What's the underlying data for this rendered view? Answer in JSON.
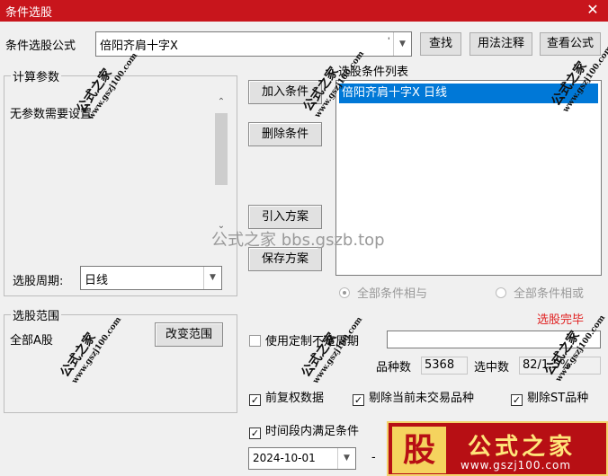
{
  "window": {
    "title": "条件选股",
    "close_glyph": "✕"
  },
  "formula": {
    "label": "条件选股公式",
    "value": "倍阳齐肩十字X",
    "search_btn": "查找",
    "usage_btn": "用法注释",
    "view_btn": "查看公式"
  },
  "params": {
    "group_title": "计算参数",
    "message": "无参数需要设置",
    "period_label": "选股周期:",
    "period_value": "日线"
  },
  "actions": {
    "add_btn": "加入条件",
    "delete_btn": "删除条件",
    "import_btn": "引入方案",
    "save_btn": "保存方案"
  },
  "conditions": {
    "title": "选股条件列表",
    "items": [
      "倍阳齐肩十字X  日线"
    ],
    "radio_and": "全部条件相与",
    "radio_or": "全部条件相或"
  },
  "scope": {
    "group_title": "选股范围",
    "value": "全部A股",
    "change_btn": "改变范围"
  },
  "options": {
    "uncertain_period_label": "使用定制不定周期",
    "uncertain_period_value": "",
    "variety_count_label": "品种数",
    "variety_count": "5368",
    "selected_label": "选中数",
    "selected_value": "82/1.5%",
    "fq_label": "前复权数据",
    "fq_checked": true,
    "exclude_untraded_label": "剔除当前未交易品种",
    "exclude_untraded_checked": true,
    "exclude_st_label": "剔除ST品种",
    "exclude_st_checked": true,
    "time_range_label": "时间段内满足条件",
    "time_range_checked": true,
    "start_date": "2024-10-01",
    "dash": "-",
    "red_text": "选股完毕"
  },
  "watermarks": {
    "site_text": "公式之家 bbs.gszb.top",
    "stamp_cn": "公式之家",
    "stamp_url": "www.gszj100.com",
    "ad_gu": "股",
    "ad_name": "公式之家",
    "ad_url": "www.gszj100.com"
  },
  "colors": {
    "titlebar": "#c8151c",
    "selection": "#0078d7",
    "red_text": "#e02020"
  }
}
